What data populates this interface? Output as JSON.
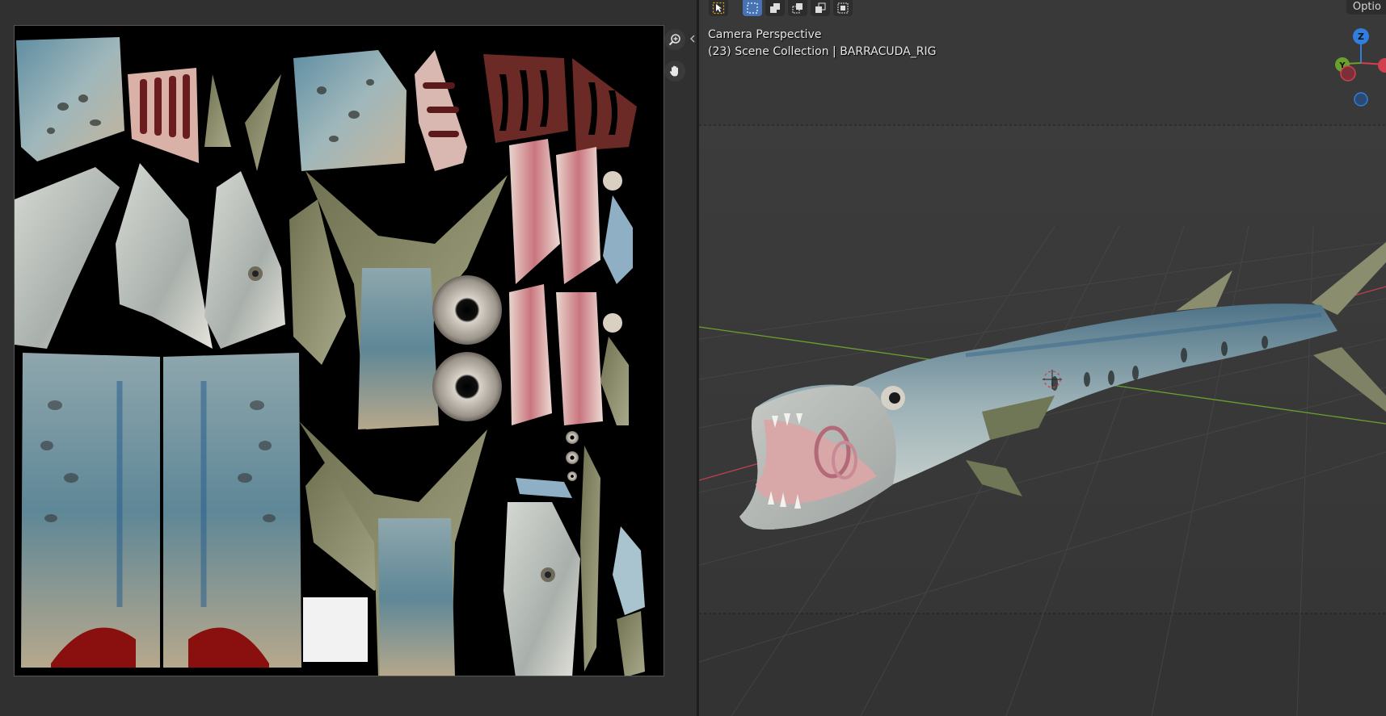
{
  "viewport": {
    "view_name": "Camera Perspective",
    "collection_info": "(23) Scene Collection | BARRACUDA_RIG",
    "options_label": "Optio",
    "gizmo": {
      "z_label": "Z",
      "y_label": "Y"
    }
  },
  "colors": {
    "ui_background": "#303030",
    "viewport_background": "#3c3c3c",
    "active_tool": "#4772b3",
    "select_tool_accent": "#e5a523",
    "axis_x": "#d0404f",
    "axis_y": "#6aa12e",
    "axis_z": "#2f7ee0"
  },
  "icons": {
    "zoom": "zoom-in-icon",
    "pan": "hand-pan-icon",
    "select": "cursor-select-icon",
    "split": "split-area-icon"
  }
}
